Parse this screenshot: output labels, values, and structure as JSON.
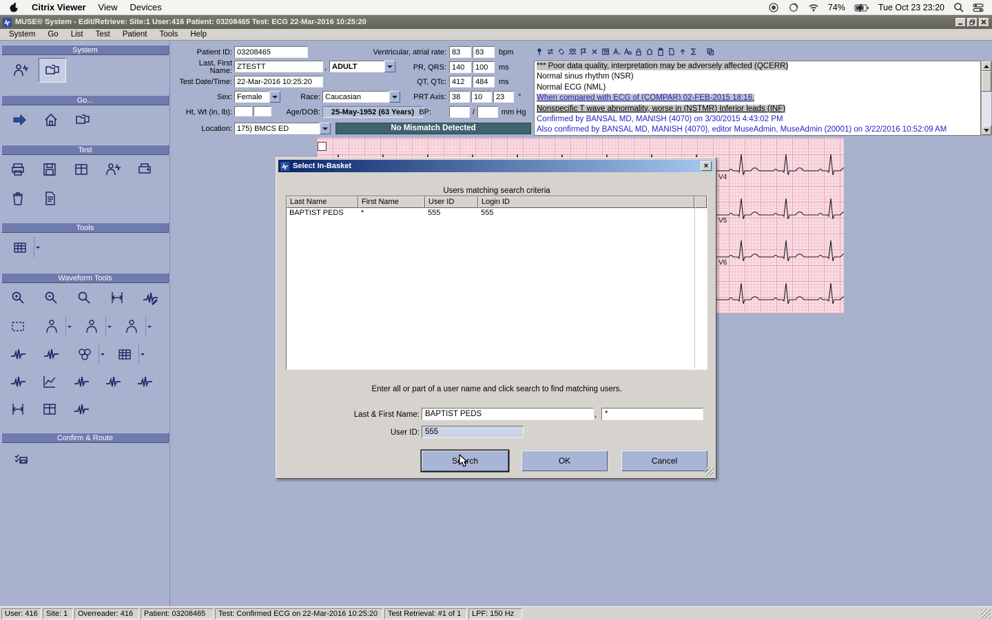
{
  "macos": {
    "app_name": "Citrix Viewer",
    "menus": [
      "View",
      "Devices"
    ],
    "battery": "74%",
    "clock": "Tue Oct 23 23:20"
  },
  "window": {
    "title": "MUSE® System - Edit/Retrieve: Site:1 User:416  Patient: 03208465  Test: ECG 22-Mar-2016 10:25:20",
    "menus": [
      "System",
      "Go",
      "List",
      "Test",
      "Patient",
      "Tools",
      "Help"
    ]
  },
  "sidebar": {
    "sections": {
      "system": "System",
      "go": "Go...",
      "test": "Test",
      "tools": "Tools",
      "waveform": "Waveform Tools",
      "confirm": "Confirm & Route"
    }
  },
  "icons": {
    "close": "×",
    "toolbar": [
      "pin",
      "swap",
      "link",
      "users",
      "delete",
      "grid",
      "font-decrease",
      "font-find",
      "lock",
      "home",
      "clipboard",
      "promote",
      "report",
      "flag",
      "sum",
      "cascade"
    ]
  },
  "patient_form": {
    "patient_id_label": "Patient ID:",
    "patient_id": "03208465",
    "name_label": "Last, First Name:",
    "last_name": "ZTESTT",
    "name_comma": ",",
    "first_name": "ADULT",
    "test_datetime_label": "Test Date/Time:",
    "test_datetime": "22-Mar-2016 10:25:20",
    "sex_label": "Sex:",
    "sex": "Female",
    "race_label": "Race:",
    "race": "Caucasian",
    "htwt_label": "Ht, Wt (in, lb):",
    "agedob_label": "Age/DOB:",
    "agedob": "25-May-1952 (63 Years)",
    "bp_label": "BP:",
    "bp_slash": "/",
    "bp_unit": "mm Hg",
    "location_label": "Location:",
    "location": "175) BMCS ED",
    "mismatch_banner": "No Mismatch Detected",
    "vent_rate_label": "Ventricular, atrial rate:",
    "vent_rate_1": "83",
    "vent_rate_2": "83",
    "vent_rate_unit": "bpm",
    "pr_qrs_label": "PR, QRS:",
    "pr": "140",
    "qrs": "100",
    "ms_unit_1": "ms",
    "qt_label": "QT, QTc:",
    "qt": "412",
    "qtc": "484",
    "ms_unit_2": "ms",
    "prt_label": "PRT Axis:",
    "prt_1": "38",
    "prt_2": "10",
    "prt_3": "23",
    "degree_unit": "°"
  },
  "interpretation": {
    "lines": [
      "*** Poor data quality, interpretation may be adversely affected (QCERR)",
      "Normal sinus rhythm (NSR)",
      "Normal ECG (NML)",
      "When compared with ECG of (COMPAR) 02-FEB-2015 18:16.",
      "Nonspecific T wave abnormality, worse in (NSTMR) Inferior leads (INF)",
      "Confirmed by BANSAL MD, MANISH (4070) on 3/30/2015 4:43:02 PM",
      "Also confirmed by BANSAL MD, MANISH (4070), editor MuseAdmin, MuseAdmin (20001)  on 3/22/2016 10:52:09 AM"
    ]
  },
  "ecg": {
    "lead_labels": [
      "V4",
      "V5",
      "V6"
    ]
  },
  "dialog": {
    "title": "Select In-Basket",
    "subtitle": "Users matching search criteria",
    "table": {
      "headers": [
        "Last Name",
        "First Name",
        "User ID",
        "Login ID"
      ],
      "rows": [
        [
          "BAPTIST PEDS",
          "*",
          "555",
          "555"
        ]
      ]
    },
    "hint": "Enter all or part of a user name and click search to find matching users.",
    "name_label": "Last & First Name:",
    "name_value": "BAPTIST PEDS",
    "comma": ",",
    "first_value": "*",
    "userid_label": "User ID:",
    "userid_value": "555",
    "buttons": {
      "search": "Search",
      "ok": "OK",
      "cancel": "Cancel"
    }
  },
  "statusbar": {
    "items": [
      "User: 416",
      "Site: 1",
      "Overreader: 416",
      "Patient: 03208465",
      "Test: Confirmed ECG on 22-Mar-2016 10:25:20",
      "Test Retrieval: #1 of 1",
      "LPF: 150 Hz"
    ]
  }
}
